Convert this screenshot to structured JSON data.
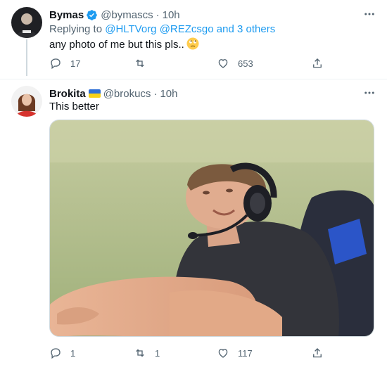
{
  "tweets": [
    {
      "name": "Bymas",
      "handle": "@bymascs",
      "dot": "·",
      "time": "10h",
      "replying_prefix": "Replying to ",
      "replying_to": [
        "@HLTVorg",
        "@REZcsgo"
      ],
      "replying_more": "and 3 others",
      "text": "any photo of me but this pls..",
      "emoji": "face-with-rolling-eyes-emoji",
      "counts": {
        "replies": "17",
        "retweets": "",
        "likes": "653"
      }
    },
    {
      "name": "Brokita",
      "handle": "@brokucs",
      "dot": "·",
      "time": "10h",
      "flag": "ukraine-flag",
      "text": "This better",
      "counts": {
        "replies": "1",
        "retweets": "1",
        "likes": "117"
      }
    }
  ],
  "colors": {
    "link": "#1d9bf0",
    "verified": "#1d9bf0",
    "muted": "#536471"
  },
  "icons": [
    "verified-badge-icon",
    "more-icon",
    "reply-icon",
    "retweet-icon",
    "like-icon",
    "share-icon"
  ]
}
